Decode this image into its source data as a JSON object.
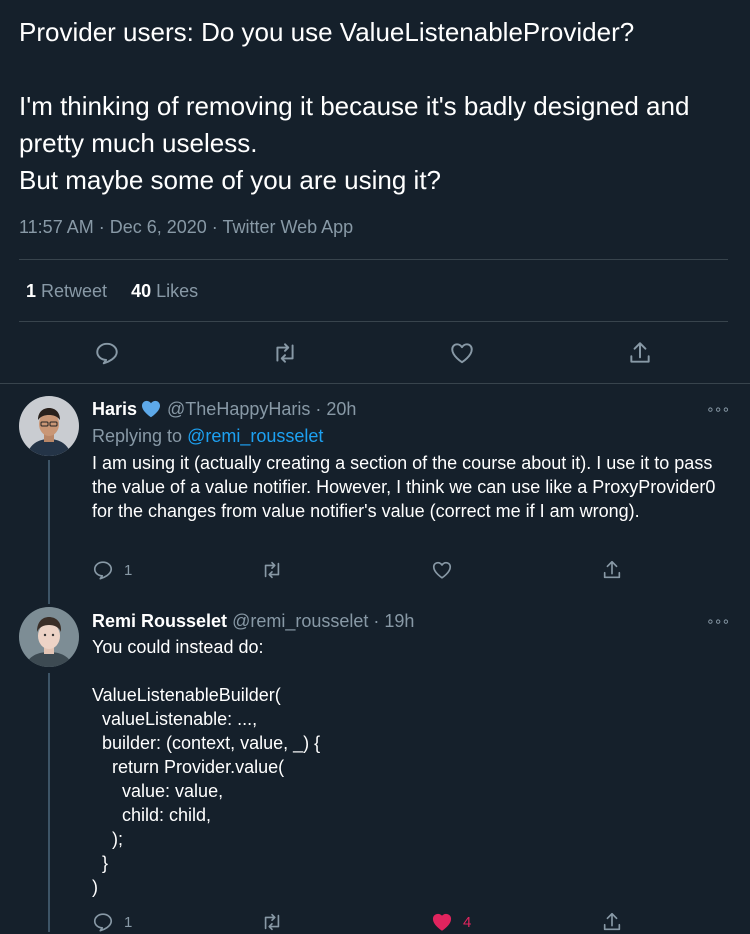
{
  "main_tweet": {
    "text": "Provider users: Do you use ValueListenableProvider?\n\nI'm thinking of removing it because it's badly designed and pretty much useless.\nBut maybe some of you are using it?",
    "meta": "11:57 AM · Dec 6, 2020 · Twitter Web App",
    "retweet_count": "1",
    "retweet_label": "Retweet",
    "like_count": "40",
    "like_label": "Likes"
  },
  "replies": [
    {
      "name": "Haris",
      "verified_emoji": "blue-heart",
      "handle": "@TheHappyHaris",
      "time": "· 20h",
      "replying_prefix": "Replying to ",
      "replying_to": "@remi_rousselet",
      "text": "I am using it (actually creating a section of the course about it). I use it to pass the value of a value notifier. However, I think we can use like a ProxyProvider0 for the changes from value notifier's value (correct me if I am wrong).",
      "reply_count": "1",
      "like_count": ""
    },
    {
      "name": "Remi Rousselet",
      "handle": "@remi_rousselet",
      "time": "· 19h",
      "text": "You could instead do:\n\nValueListenableBuilder(\n  valueListenable: ...,\n  builder: (context, value, _) {\n    return Provider.value(\n      value: value,\n      child: child,\n    );\n  }\n)",
      "reply_count": "1",
      "like_count": "4"
    }
  ],
  "more_glyph": "∘∘∘",
  "colors": {
    "background": "#15202b",
    "divider": "#38444d",
    "muted": "#8899a6",
    "link": "#1da1f2",
    "like": "#e0245e"
  },
  "icons": [
    "reply-icon",
    "retweet-icon",
    "like-icon",
    "share-icon",
    "more-icon",
    "blue-heart-icon"
  ]
}
